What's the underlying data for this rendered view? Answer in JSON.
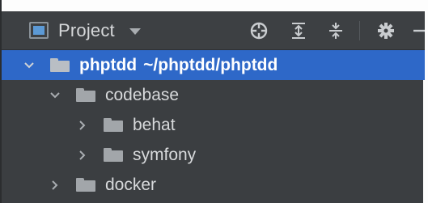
{
  "header": {
    "title": "Project",
    "tools": [
      "locate-icon",
      "expand-all-icon",
      "collapse-all-icon",
      "gear-icon",
      "minimize-icon"
    ]
  },
  "tree": {
    "items": [
      {
        "label": "phptdd",
        "path": "~/phptdd/phptdd",
        "expanded": true,
        "selected": true
      },
      {
        "label": "codebase",
        "expanded": true
      },
      {
        "label": "behat",
        "expanded": false
      },
      {
        "label": "symfony",
        "expanded": false
      },
      {
        "label": "docker",
        "expanded": false
      }
    ]
  },
  "colors": {
    "background": "#3b3e41",
    "selection": "#2e68c8",
    "text": "#d8dadc",
    "folder": "#a2a6aa",
    "project_icon_accent": "#5c9ad6"
  }
}
